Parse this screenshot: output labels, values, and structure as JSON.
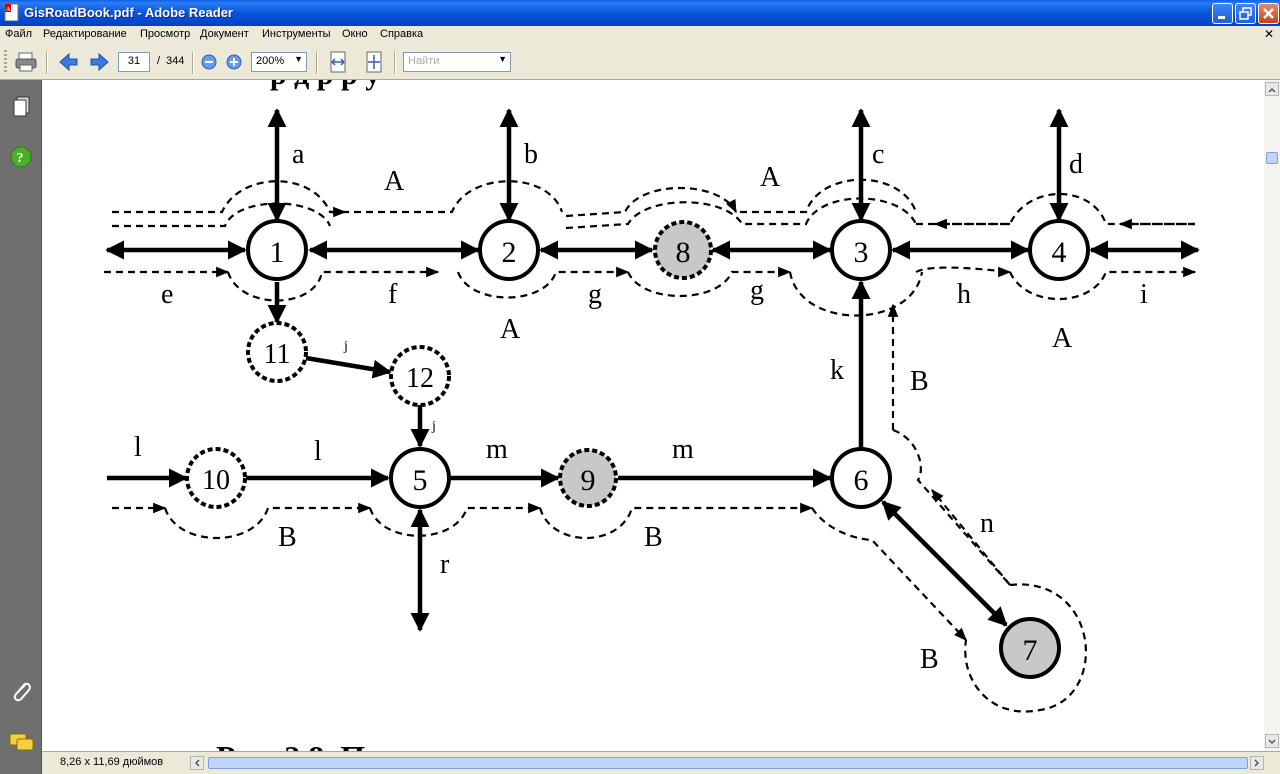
{
  "window": {
    "title": "GisRoadBook.pdf - Adobe Reader"
  },
  "menu": [
    "Файл",
    "Редактирование",
    "Просмотр",
    "Документ",
    "Инструменты",
    "Окно",
    "Справка"
  ],
  "toolbar": {
    "page_current": "31",
    "page_sep": "/",
    "page_total": "344",
    "zoom": "200%",
    "find_placeholder": "Найти"
  },
  "status": {
    "page_size": "8,26 x 11,69 дюймов"
  },
  "diagram": {
    "nodes": {
      "n1": "1",
      "n2": "2",
      "n8": "8",
      "n3": "3",
      "n4": "4",
      "n11": "11",
      "n12": "12",
      "n10": "10",
      "n5": "5",
      "n9": "9",
      "n6": "6",
      "n7": "7"
    },
    "labels": {
      "a": "a",
      "b": "b",
      "c": "c",
      "d": "d",
      "e": "e",
      "f": "f",
      "g1": "g",
      "g2": "g",
      "h": "h",
      "i": "i",
      "A1": "A",
      "A2": "A",
      "A3": "A",
      "A4": "A",
      "k": "k",
      "B1": "B",
      "B2": "B",
      "B3": "B",
      "B4": "B",
      "l1": "l",
      "l2": "l",
      "m1": "m",
      "m2": "m",
      "r": "r",
      "n": "n",
      "j1": "j",
      "j2": "j",
      "top_cut": "р                                                        д р          р       у",
      "caption_cut": "Рис. 2.8. П"
    }
  }
}
